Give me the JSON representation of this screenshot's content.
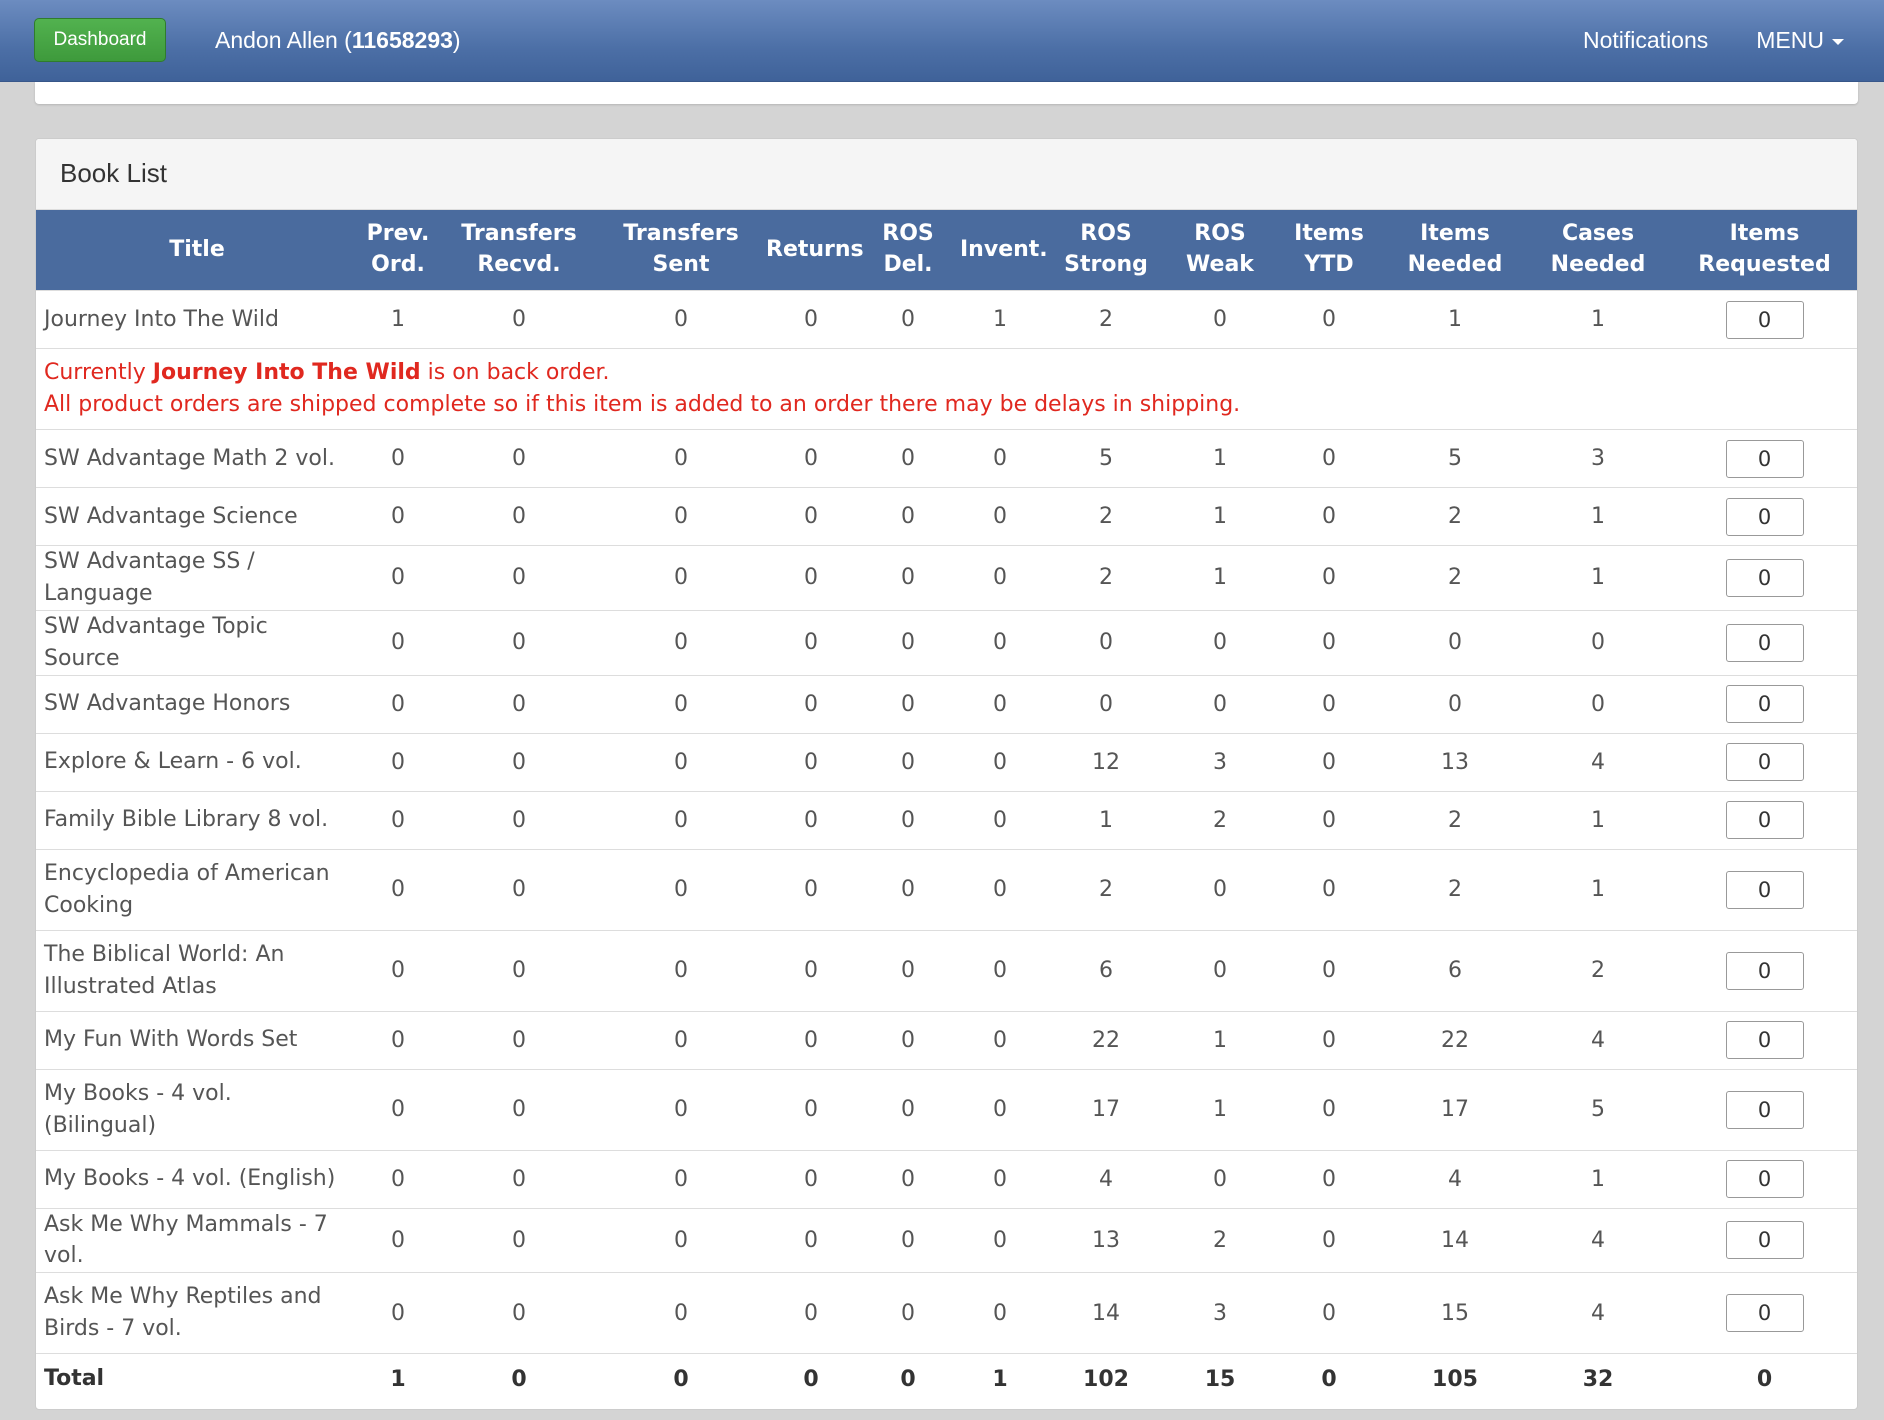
{
  "navbar": {
    "dashboard_label": "Dashboard",
    "user_name": "Andon Allen",
    "user_open": " (",
    "user_id": "11658293",
    "user_close": ")",
    "notifications_label": "Notifications",
    "menu_label": "MENU"
  },
  "panel": {
    "title": "Book List"
  },
  "table": {
    "headers": [
      [
        "Title"
      ],
      [
        "Prev.",
        "Ord."
      ],
      [
        "Transfers",
        "Recvd."
      ],
      [
        "Transfers",
        "Sent"
      ],
      [
        "Returns"
      ],
      [
        "ROS",
        "Del."
      ],
      [
        "Invent."
      ],
      [
        "ROS",
        "Strong"
      ],
      [
        "ROS",
        "Weak"
      ],
      [
        "Items",
        "YTD"
      ],
      [
        "Items",
        "Needed"
      ],
      [
        "Cases",
        "Needed"
      ],
      [
        "Items",
        "Requested"
      ]
    ],
    "rows": [
      {
        "title": "Journey Into The Wild",
        "values": [
          "1",
          "0",
          "0",
          "0",
          "0",
          "1",
          "2",
          "0",
          "0",
          "1",
          "1"
        ],
        "requested": "0",
        "alert": {
          "pre": "Currently ",
          "book": "Journey Into The Wild",
          "post": " is on back order.",
          "line2": "All product orders are shipped complete so if this item is added to an order there may be delays in shipping."
        }
      },
      {
        "title": "SW Advantage Math 2 vol.",
        "values": [
          "0",
          "0",
          "0",
          "0",
          "0",
          "0",
          "5",
          "1",
          "0",
          "5",
          "3"
        ],
        "requested": "0"
      },
      {
        "title": "SW Advantage Science",
        "values": [
          "0",
          "0",
          "0",
          "0",
          "0",
          "0",
          "2",
          "1",
          "0",
          "2",
          "1"
        ],
        "requested": "0"
      },
      {
        "title": "SW Advantage SS / Language",
        "values": [
          "0",
          "0",
          "0",
          "0",
          "0",
          "0",
          "2",
          "1",
          "0",
          "2",
          "1"
        ],
        "requested": "0"
      },
      {
        "title": "SW Advantage Topic Source",
        "values": [
          "0",
          "0",
          "0",
          "0",
          "0",
          "0",
          "0",
          "0",
          "0",
          "0",
          "0"
        ],
        "requested": "0"
      },
      {
        "title": "SW Advantage Honors",
        "values": [
          "0",
          "0",
          "0",
          "0",
          "0",
          "0",
          "0",
          "0",
          "0",
          "0",
          "0"
        ],
        "requested": "0"
      },
      {
        "title": "Explore & Learn - 6 vol.",
        "values": [
          "0",
          "0",
          "0",
          "0",
          "0",
          "0",
          "12",
          "3",
          "0",
          "13",
          "4"
        ],
        "requested": "0"
      },
      {
        "title": "Family Bible Library 8 vol.",
        "values": [
          "0",
          "0",
          "0",
          "0",
          "0",
          "0",
          "1",
          "2",
          "0",
          "2",
          "1"
        ],
        "requested": "0"
      },
      {
        "title": "Encyclopedia of American Cooking",
        "values": [
          "0",
          "0",
          "0",
          "0",
          "0",
          "0",
          "2",
          "0",
          "0",
          "2",
          "1"
        ],
        "requested": "0"
      },
      {
        "title": "The Biblical World: An Illustrated Atlas",
        "values": [
          "0",
          "0",
          "0",
          "0",
          "0",
          "0",
          "6",
          "0",
          "0",
          "6",
          "2"
        ],
        "requested": "0"
      },
      {
        "title": "My Fun With Words Set",
        "values": [
          "0",
          "0",
          "0",
          "0",
          "0",
          "0",
          "22",
          "1",
          "0",
          "22",
          "4"
        ],
        "requested": "0"
      },
      {
        "title": "My Books - 4 vol. (Bilingual)",
        "values": [
          "0",
          "0",
          "0",
          "0",
          "0",
          "0",
          "17",
          "1",
          "0",
          "17",
          "5"
        ],
        "requested": "0"
      },
      {
        "title": "My Books - 4 vol. (English)",
        "values": [
          "0",
          "0",
          "0",
          "0",
          "0",
          "0",
          "4",
          "0",
          "0",
          "4",
          "1"
        ],
        "requested": "0"
      },
      {
        "title": "Ask Me Why Mammals - 7 vol.",
        "values": [
          "0",
          "0",
          "0",
          "0",
          "0",
          "0",
          "13",
          "2",
          "0",
          "14",
          "4"
        ],
        "requested": "0"
      },
      {
        "title": "Ask Me Why Reptiles and Birds - 7 vol.",
        "values": [
          "0",
          "0",
          "0",
          "0",
          "0",
          "0",
          "14",
          "3",
          "0",
          "15",
          "4"
        ],
        "requested": "0"
      }
    ],
    "total": {
      "label": "Total",
      "values": [
        "1",
        "0",
        "0",
        "0",
        "0",
        "1",
        "102",
        "15",
        "0",
        "105",
        "32",
        "0"
      ]
    }
  },
  "colors": {
    "navbar": "#4c6fa6",
    "header": "#4a6b9e",
    "dashboard_button": "#46a543",
    "alert_text": "#e0281f"
  }
}
